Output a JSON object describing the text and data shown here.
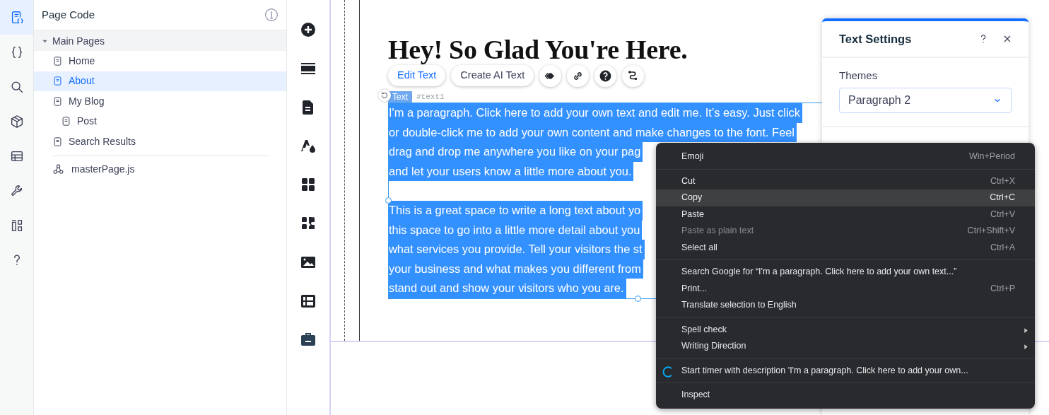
{
  "rail": {
    "items": [
      {
        "kind": "page-code",
        "selected": true
      },
      {
        "kind": "braces",
        "selected": false
      },
      {
        "kind": "search",
        "selected": false
      },
      {
        "kind": "package",
        "selected": false
      },
      {
        "kind": "database",
        "selected": false
      },
      {
        "kind": "wrench",
        "selected": false
      },
      {
        "kind": "widgets",
        "selected": false
      },
      {
        "kind": "help",
        "selected": false
      }
    ]
  },
  "code_panel": {
    "title": "Page Code",
    "section": {
      "label": "Main Pages",
      "expanded": true,
      "children": [
        {
          "label": "Home",
          "selected": false
        },
        {
          "label": "About",
          "selected": true
        },
        {
          "label": "My Blog",
          "selected": false,
          "children": [
            {
              "label": "Post",
              "selected": false
            }
          ]
        },
        {
          "label": "Search Results",
          "selected": false
        }
      ]
    },
    "master_file": "masterPage.js"
  },
  "add_tools": [
    {
      "kind": "add"
    },
    {
      "kind": "strip"
    },
    {
      "kind": "page"
    },
    {
      "kind": "theme"
    },
    {
      "kind": "apps"
    },
    {
      "kind": "puzzle"
    },
    {
      "kind": "media"
    },
    {
      "kind": "cms"
    },
    {
      "kind": "business"
    }
  ],
  "canvas": {
    "heading": "Hey! So Glad You're Here.",
    "toolbar": {
      "buttons": [
        {
          "label": "Edit Text",
          "primary": true
        },
        {
          "label": "Create AI Text",
          "primary": false
        }
      ],
      "icon_buttons": [
        {
          "kind": "animation"
        },
        {
          "kind": "link"
        },
        {
          "kind": "help"
        },
        {
          "kind": "connect"
        }
      ]
    },
    "element_tag": "Text",
    "element_id": "#text1",
    "paragraphs": [
      [
        "I'm a paragraph. Click here to add your own text and edit me. It’s easy. Just click",
        "or double-click me to add your own content and make changes to the font. Feel",
        "drag and drop me anywhere you like on your pag",
        "and let your users know a little more about you."
      ],
      [
        "This is a great space to write a long text about yo",
        "this space to go into a little more detail about you",
        "what services you provide. Tell your visitors the st",
        "your business and what makes you different from",
        "stand out and show your visitors who you are."
      ]
    ]
  },
  "text_settings": {
    "title": "Text Settings",
    "themes_label": "Themes",
    "theme_value": "Paragraph 2"
  },
  "context_menu": {
    "groups": [
      [
        {
          "kind": "plain",
          "label": "Emoji",
          "shortcut": "Win+Period",
          "highlighted": false,
          "disabled": false,
          "submenu": false
        }
      ],
      [
        {
          "kind": "plain",
          "label": "Cut",
          "shortcut": "Ctrl+X",
          "highlighted": false,
          "disabled": false,
          "submenu": false
        },
        {
          "kind": "plain",
          "label": "Copy",
          "shortcut": "Ctrl+C",
          "highlighted": true,
          "disabled": false,
          "submenu": false
        },
        {
          "kind": "plain",
          "label": "Paste",
          "shortcut": "Ctrl+V",
          "highlighted": false,
          "disabled": false,
          "submenu": false
        },
        {
          "kind": "plain",
          "label": "Paste as plain text",
          "shortcut": "Ctrl+Shift+V",
          "highlighted": false,
          "disabled": true,
          "submenu": false
        },
        {
          "kind": "plain",
          "label": "Select all",
          "shortcut": "Ctrl+A",
          "highlighted": false,
          "disabled": false,
          "submenu": false
        }
      ],
      [
        {
          "kind": "plain",
          "label": "Search Google for “I'm a paragraph. Click here to add your own text...”",
          "highlighted": false,
          "disabled": false,
          "submenu": false
        },
        {
          "kind": "plain",
          "label": "Print...",
          "shortcut": "Ctrl+P",
          "highlighted": false,
          "disabled": false,
          "submenu": false
        },
        {
          "kind": "plain",
          "label": "Translate selection to English",
          "highlighted": false,
          "disabled": false,
          "submenu": false
        }
      ],
      [
        {
          "kind": "plain",
          "label": "Spell check",
          "highlighted": false,
          "disabled": false,
          "submenu": true
        },
        {
          "kind": "plain",
          "label": "Writing Direction",
          "highlighted": false,
          "disabled": false,
          "submenu": true
        }
      ],
      [
        {
          "kind": "timer",
          "label": "Start timer with description 'I'm a paragraph. Click here to add your own...",
          "highlighted": false,
          "disabled": false,
          "submenu": false
        }
      ],
      [
        {
          "kind": "plain",
          "label": "Inspect",
          "highlighted": false,
          "disabled": false,
          "submenu": false
        }
      ]
    ]
  }
}
